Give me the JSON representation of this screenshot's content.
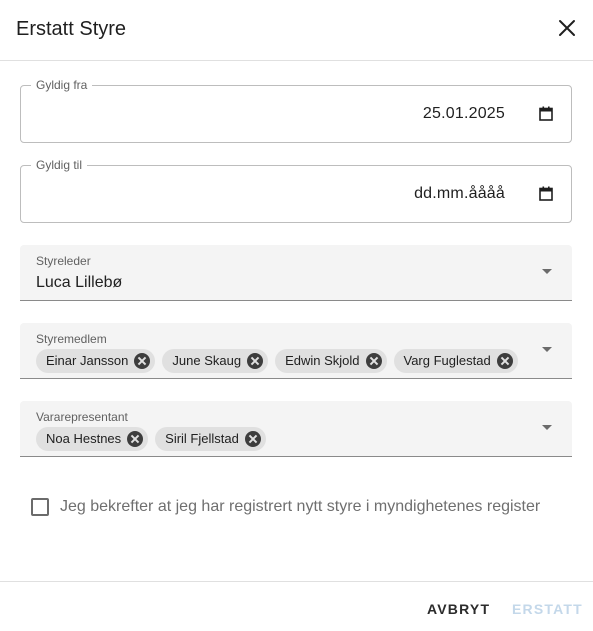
{
  "dialog": {
    "title": "Erstatt Styre",
    "close_icon": "close-icon"
  },
  "fields": {
    "valid_from": {
      "label": "Gyldig fra",
      "value": "25.01.2025",
      "icon": "calendar-icon"
    },
    "valid_to": {
      "label": "Gyldig til",
      "value": "dd.mm.åååå",
      "icon": "calendar-icon"
    },
    "chair": {
      "label": "Styreleder",
      "value": "Luca Lillebø"
    },
    "members": {
      "label": "Styremedlem",
      "chips": [
        "Einar Jansson",
        "June Skaug",
        "Edwin Skjold",
        "Varg Fuglestad"
      ]
    },
    "deputies": {
      "label": "Vararepresentant",
      "chips": [
        "Noa Hestnes",
        "Siril Fjellstad"
      ]
    }
  },
  "confirmation": {
    "label": "Jeg bekrefter at jeg har registrert nytt styre i myndighetenes register",
    "checked": false
  },
  "actions": {
    "cancel_label": "AVBRYT",
    "submit_label": "ERSTATT",
    "submit_disabled": true
  },
  "colors": {
    "disabled_button": "#c4d8ea",
    "chip_background": "#e0e0e0",
    "field_fill": "#f4f4f4"
  }
}
